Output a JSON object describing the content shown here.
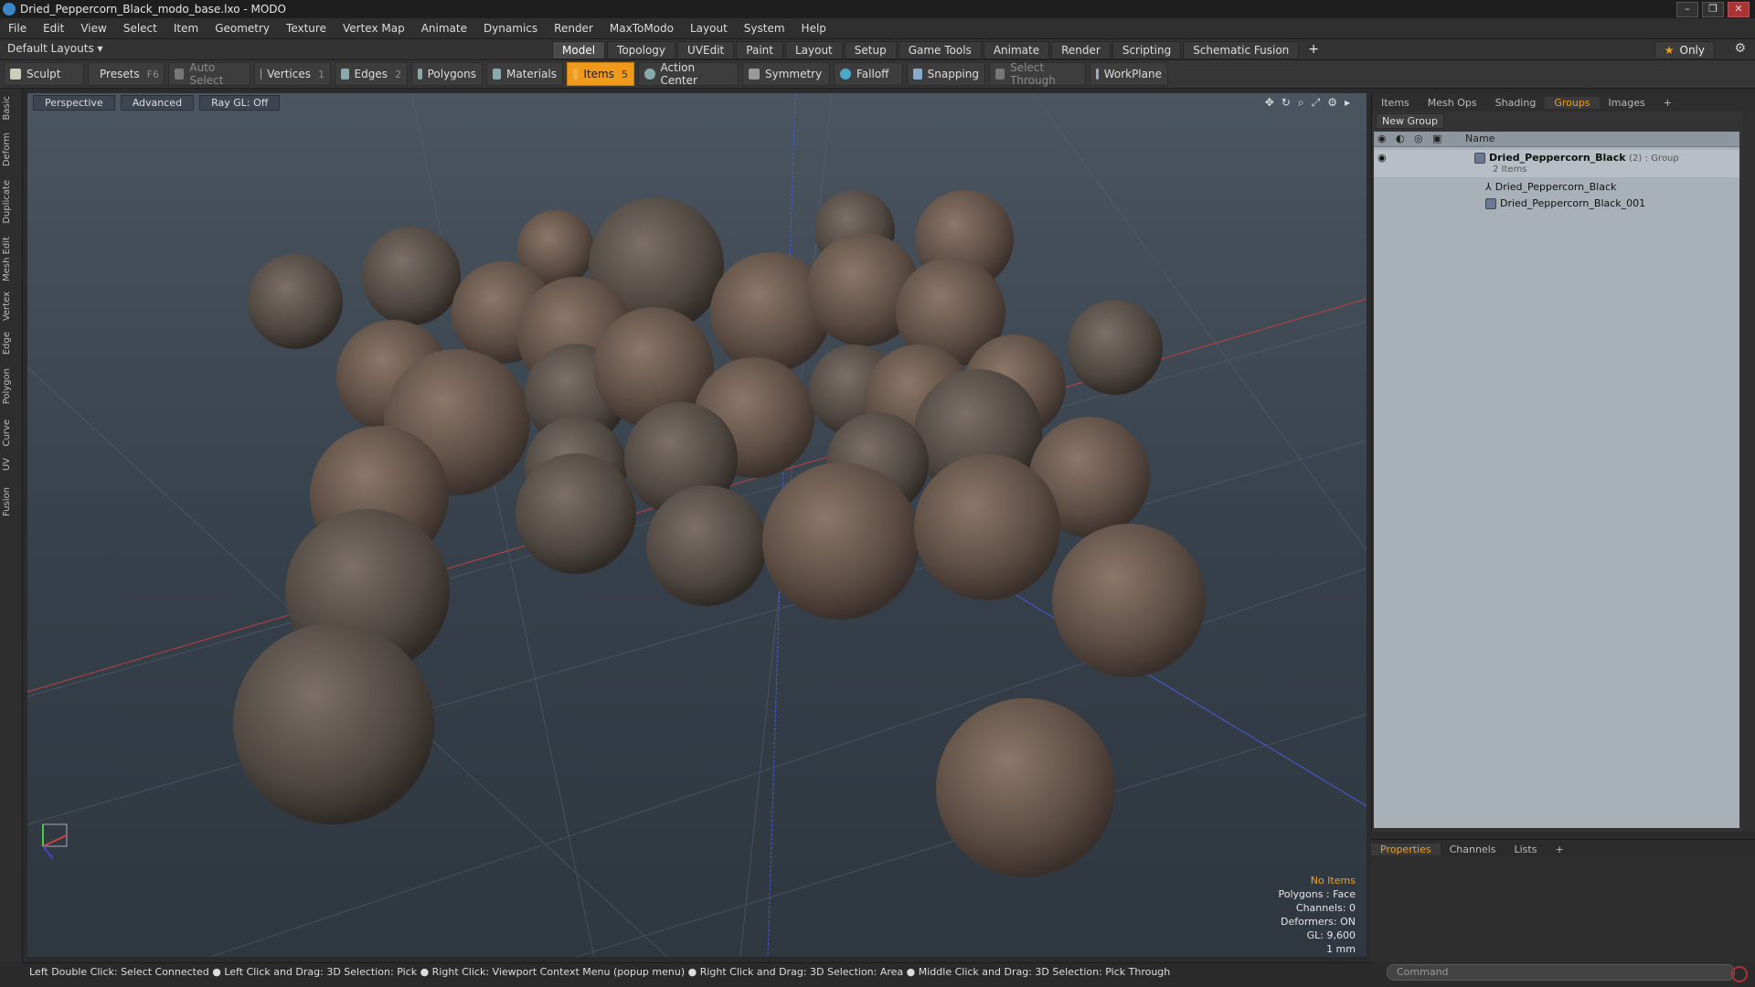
{
  "window": {
    "title": "Dried_Peppercorn_Black_modo_base.lxo - MODO"
  },
  "menu": [
    "File",
    "Edit",
    "View",
    "Select",
    "Item",
    "Geometry",
    "Texture",
    "Vertex Map",
    "Animate",
    "Dynamics",
    "Render",
    "MaxToModo",
    "Layout",
    "System",
    "Help"
  ],
  "layoutbar": {
    "default_layouts": "Default Layouts ▾",
    "tabs": [
      "Model",
      "Topology",
      "UVEdit",
      "Paint",
      "Layout",
      "Setup",
      "Game Tools",
      "Animate",
      "Render",
      "Scripting",
      "Schematic Fusion"
    ],
    "active_tab": "Model",
    "plus": "+",
    "only": "Only"
  },
  "toolbar": {
    "sculpt": "Sculpt",
    "presets": "Presets",
    "presets_key": "F6",
    "auto_select": "Auto Select",
    "vertices": "Vertices",
    "vertices_count": "1",
    "edges": "Edges",
    "edges_count": "2",
    "polygons": "Polygons",
    "materials": "Materials",
    "items": "Items",
    "items_count": "5",
    "action_center": "Action Center",
    "symmetry": "Symmetry",
    "falloff": "Falloff",
    "snapping": "Snapping",
    "select_through": "Select Through",
    "workplane": "WorkPlane"
  },
  "lefttabs": [
    "Basic",
    "Deform",
    "Duplicate",
    "Mesh Edit",
    "Vertex",
    "Edge",
    "Polygon",
    "Curve",
    "UV",
    "Fusion"
  ],
  "viewport": {
    "view": "Perspective",
    "shading": "Advanced",
    "raygl": "Ray GL: Off",
    "stats": {
      "no_items": "No Items",
      "polygons": "Polygons : Face",
      "channels": "Channels: 0",
      "deformers": "Deformers: ON",
      "gl": "GL: 9,600",
      "unit": "1 mm"
    }
  },
  "status": "Left Double Click: Select Connected ● Left Click and Drag: 3D Selection: Pick ● Right Click: Viewport Context Menu (popup menu) ● Right Click and Drag: 3D Selection: Area ● Middle Click and Drag: 3D Selection: Pick Through",
  "rpanel": {
    "tabs": [
      "Items",
      "Mesh Ops",
      "Shading",
      "Groups",
      "Images"
    ],
    "active_tab": "Groups",
    "plus": "+",
    "new_group": "New Group",
    "col_name": "Name",
    "group": {
      "name": "Dried_Peppercorn_Black",
      "count": "(2)",
      "type": ": Group",
      "sub": "2 Items"
    },
    "children": [
      "Dried_Peppercorn_Black",
      "Dried_Peppercorn_Black_001"
    ]
  },
  "ppanel": {
    "tabs": [
      "Properties",
      "Channels",
      "Lists"
    ],
    "active_tab": "Properties",
    "plus": "+"
  },
  "command": {
    "placeholder": "Command"
  },
  "colors": {
    "accent": "#f09a1c",
    "viewport_bg": "#3a444e"
  }
}
